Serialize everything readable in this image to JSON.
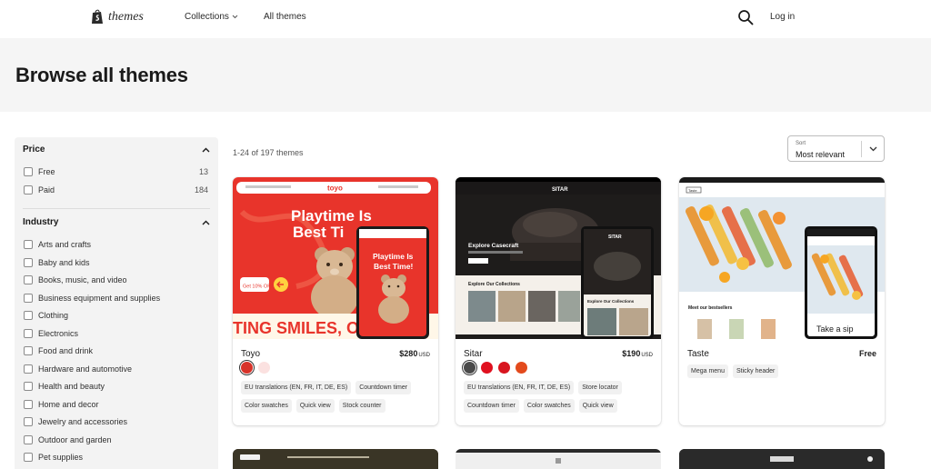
{
  "header": {
    "logo_text": "themes",
    "nav": {
      "collections": "Collections",
      "all_themes": "All themes"
    },
    "login": "Log in"
  },
  "hero": {
    "title": "Browse all themes"
  },
  "sidebar": {
    "price": {
      "title": "Price",
      "options": [
        {
          "label": "Free",
          "count": "13"
        },
        {
          "label": "Paid",
          "count": "184"
        }
      ]
    },
    "industry": {
      "title": "Industry",
      "options": [
        "Arts and crafts",
        "Baby and kids",
        "Books, music, and video",
        "Business equipment and supplies",
        "Clothing",
        "Electronics",
        "Food and drink",
        "Hardware and automotive",
        "Health and beauty",
        "Home and decor",
        "Jewelry and accessories",
        "Outdoor and garden",
        "Pet supplies"
      ]
    }
  },
  "results": {
    "count_text": "1-24 of 197 themes"
  },
  "sort": {
    "label": "Sort",
    "value": "Most relevant"
  },
  "cards": [
    {
      "name": "Toyo",
      "price": "$280",
      "currency": "USD",
      "swatches": [
        "#d8332a",
        "#fbe1e0"
      ],
      "tags": [
        "EU translations (EN, FR, IT, DE, ES)",
        "Countdown timer",
        "Color swatches",
        "Quick view",
        "Stock counter"
      ],
      "thumb": {
        "brand": "toyo",
        "headline": "Playtime Is Best Time!",
        "mobile_headline": "Playtime Is Best Time!",
        "banner": "TING SMILES, O",
        "promo": "Get 10% OFF"
      }
    },
    {
      "name": "Sitar",
      "price": "$190",
      "currency": "USD",
      "swatches": [
        "#4a4a4a",
        "#e0101f",
        "#d8151f",
        "#e34a1c"
      ],
      "tags": [
        "EU translations (EN, FR, IT, DE, ES)",
        "Store locator",
        "Countdown timer",
        "Color swatches",
        "Quick view"
      ],
      "thumb": {
        "brand": "SITAR",
        "hero_title": "Explore Casecraft",
        "section_title": "Explore Our Collections",
        "mobile_title": "Explore Our Collections"
      }
    },
    {
      "name": "Taste",
      "price": "Free",
      "currency": "",
      "swatches": [],
      "tags": [
        "Mega menu",
        "Sticky header"
      ],
      "thumb": {
        "brand": "Taste",
        "best": "Meet our bestsellers",
        "mobile_caption": "Take a sip"
      }
    }
  ],
  "colors": {
    "hero_bg": "#f5f5f5",
    "sidebar_bg": "#f3f3f3",
    "toyo_red": "#e8342b",
    "sitar_dark": "#1e1c1b"
  }
}
